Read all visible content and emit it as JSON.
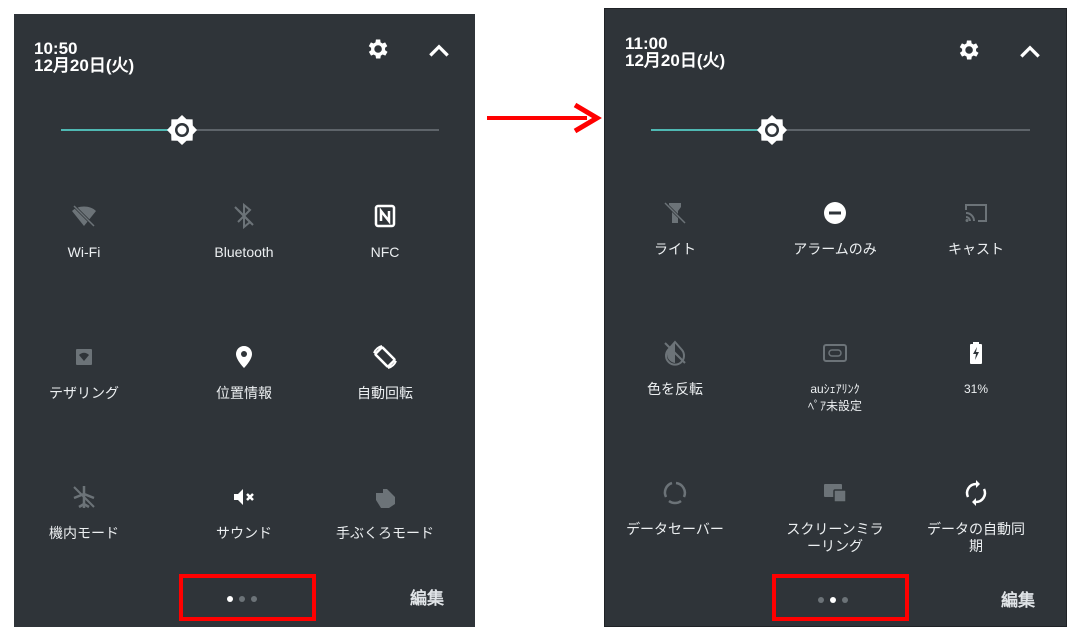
{
  "left_panel": {
    "time": "10:50",
    "date": "12月20日(火)",
    "tiles": [
      {
        "icon": "wifi-off-icon",
        "label": "Wi-Fi",
        "active": false
      },
      {
        "icon": "bluetooth-off-icon",
        "label": "Bluetooth",
        "active": false
      },
      {
        "icon": "nfc-icon",
        "label": "NFC",
        "active": true
      },
      {
        "icon": "tethering-icon",
        "label": "テザリング",
        "active": false
      },
      {
        "icon": "location-icon",
        "label": "位置情報",
        "active": true
      },
      {
        "icon": "auto-rotate-icon",
        "label": "自動回転",
        "active": true
      },
      {
        "icon": "airplane-mode-icon",
        "label": "機内モード",
        "active": false
      },
      {
        "icon": "sound-mute-icon",
        "label": "サウンド",
        "active": true
      },
      {
        "icon": "glove-mode-icon",
        "label": "手ぶくろモード",
        "active": false
      }
    ],
    "page_indicator": {
      "count": 3,
      "active": 0
    },
    "edit_label": "編集"
  },
  "right_panel": {
    "time": "11:00",
    "date": "12月20日(火)",
    "tiles": [
      {
        "icon": "flashlight-icon",
        "label": "ライト",
        "active": false
      },
      {
        "icon": "do-not-disturb-icon",
        "label": "アラームのみ",
        "active": true
      },
      {
        "icon": "cast-icon",
        "label": "キャスト",
        "active": false
      },
      {
        "icon": "invert-colors-icon",
        "label": "色を反転",
        "active": false
      },
      {
        "icon": "au-share-link-icon",
        "label": "auｼｪｱﾘﾝｸ\nﾍﾟｱ未設定",
        "active": false
      },
      {
        "icon": "battery-icon",
        "label": "31%",
        "active": true
      },
      {
        "icon": "data-saver-icon",
        "label": "データセーバー",
        "active": false
      },
      {
        "icon": "screen-mirroring-icon",
        "label": "スクリーンミラ\nーリング",
        "active": false
      },
      {
        "icon": "auto-sync-icon",
        "label": "データの自動同\n期",
        "active": true
      }
    ],
    "page_indicator": {
      "count": 3,
      "active": 1
    },
    "edit_label": "編集"
  },
  "brightness": {
    "level": 0.32
  },
  "colors": {
    "panel_bg": "#2f3439",
    "slider_fill": "#4fb8b3",
    "active_icon": "#ffffff",
    "inactive_icon": "#6c7378",
    "highlight": "#ff0000",
    "arrow": "#ff0000"
  }
}
